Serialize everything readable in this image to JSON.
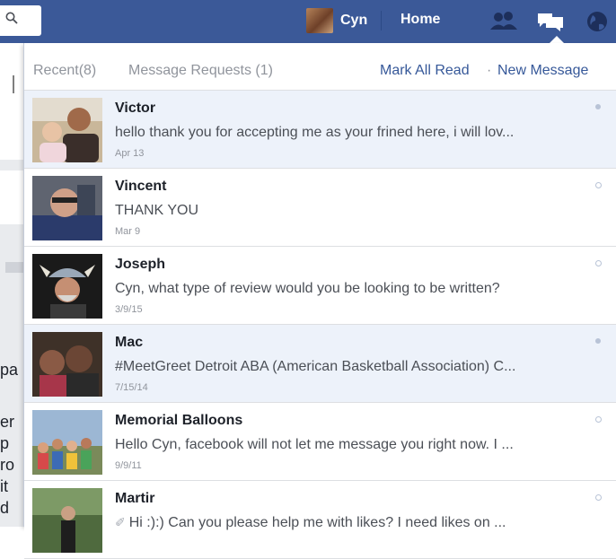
{
  "topbar": {
    "profile_name": "Cyn",
    "home_label": "Home",
    "icons": [
      "search-icon",
      "friend-requests-icon",
      "messages-icon",
      "globe-icon"
    ]
  },
  "background_fragments": [
    "pa",
    "er",
    "p",
    "ro",
    "it",
    "d"
  ],
  "dropdown": {
    "tab_recent": "Recent(8)",
    "tab_requests": "Message Requests (1)",
    "mark_all_read": "Mark All Read",
    "separator": "·",
    "new_message": "New Message"
  },
  "threads": [
    {
      "name": "Victor",
      "snippet": "hello thank you for accepting me as your frined here, i will lov...",
      "date": "Apr 13",
      "unread": true
    },
    {
      "name": "Vincent",
      "snippet": "THANK YOU",
      "date": "Mar 9",
      "unread": false
    },
    {
      "name": "Joseph",
      "snippet": "Cyn, what type of review would you be looking to be written?",
      "date": "3/9/15",
      "unread": false
    },
    {
      "name": "Mac",
      "snippet": "#MeetGreet Detroit ABA (American Basketball Association) C...",
      "date": "7/15/14",
      "unread": true
    },
    {
      "name": "Memorial Balloons",
      "snippet": "Hello Cyn, facebook will not let me message you right now. I ...",
      "date": "9/9/11",
      "unread": false
    },
    {
      "name": "Martir",
      "snippet": "Hi :):) Can you please help me with likes? I need likes on ...",
      "date": "",
      "unread": false
    }
  ],
  "colors": {
    "topbar": "#3b5998",
    "link": "#365899",
    "unread_row": "#edf2fa"
  }
}
